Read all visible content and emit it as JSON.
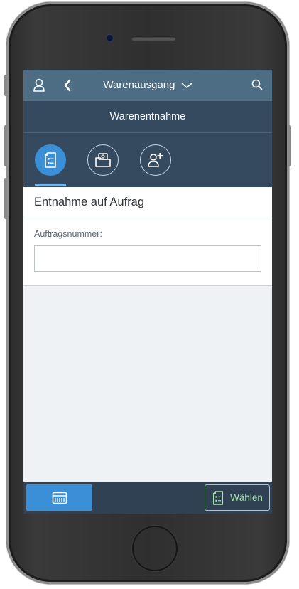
{
  "header": {
    "app_title": "Warenausgang",
    "icons": [
      "user-icon",
      "back-chevron-icon",
      "dropdown-chevron-icon",
      "search-icon"
    ]
  },
  "subheader": {
    "title": "Warenentnahme"
  },
  "tabs": [
    {
      "name": "order-document",
      "icon": "document-list-icon",
      "active": true
    },
    {
      "name": "money-folder",
      "icon": "folder-cash-icon",
      "active": false
    },
    {
      "name": "add-person",
      "icon": "add-user-icon",
      "active": false
    }
  ],
  "panel": {
    "title": "Entnahme auf Aufrag",
    "field_label": "Auftragsnummer:",
    "field_value": "",
    "field_placeholder": ""
  },
  "footer": {
    "scan_icon": "barcode-scanner-icon",
    "select_label": "Wählen",
    "select_icon": "document-list-icon"
  },
  "colors": {
    "header_bg": "#4d6d84",
    "subheader_bg": "#354a5e",
    "accent": "#3b8fd6",
    "footer_bg": "#2f4152",
    "select_border": "#9bd5a2"
  }
}
